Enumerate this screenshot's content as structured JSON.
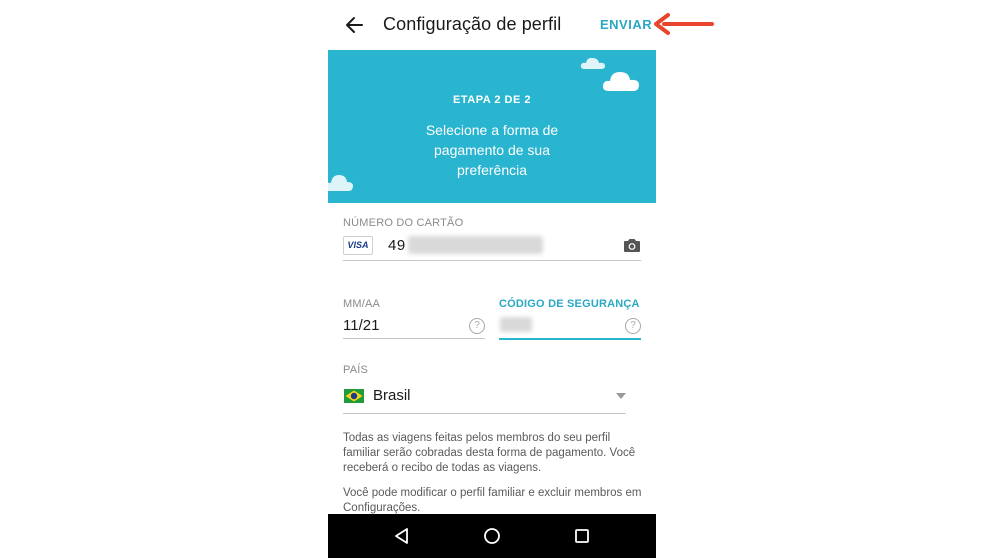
{
  "header": {
    "title": "Configuração de perfil",
    "send_label": "ENVIAR"
  },
  "banner": {
    "step": "ETAPA 2 DE 2",
    "message": "Selecione a forma de pagamento de sua preferência",
    "color": "#29b4cf"
  },
  "card": {
    "label": "NÚMERO DO CARTÃO",
    "brand": "VISA",
    "number_visible": "49"
  },
  "expiry": {
    "label": "MM/AA",
    "value": "11/21",
    "help": "?"
  },
  "security": {
    "label": "CÓDIGO DE SEGURANÇA",
    "help": "?"
  },
  "country": {
    "label": "PAÍS",
    "value": "Brasil"
  },
  "info": {
    "paragraph1": "Todas as viagens feitas pelos membros do seu perfil familiar serão cobradas desta forma de pagamento. Você receberá o recibo de todas as viagens.",
    "paragraph2": "Você pode modificar o perfil familiar e excluir membros em Configurações."
  },
  "colors": {
    "accent": "#2aa8c4",
    "annotation": "#e8452c"
  },
  "icons": {
    "back": "arrow-left-icon",
    "camera": "camera-icon",
    "help": "help-circle-icon",
    "caret": "chevron-down-icon",
    "flag": "brazil-flag-icon",
    "nav_back": "nav-back-icon",
    "nav_home": "nav-home-icon",
    "nav_recents": "nav-recents-icon"
  }
}
